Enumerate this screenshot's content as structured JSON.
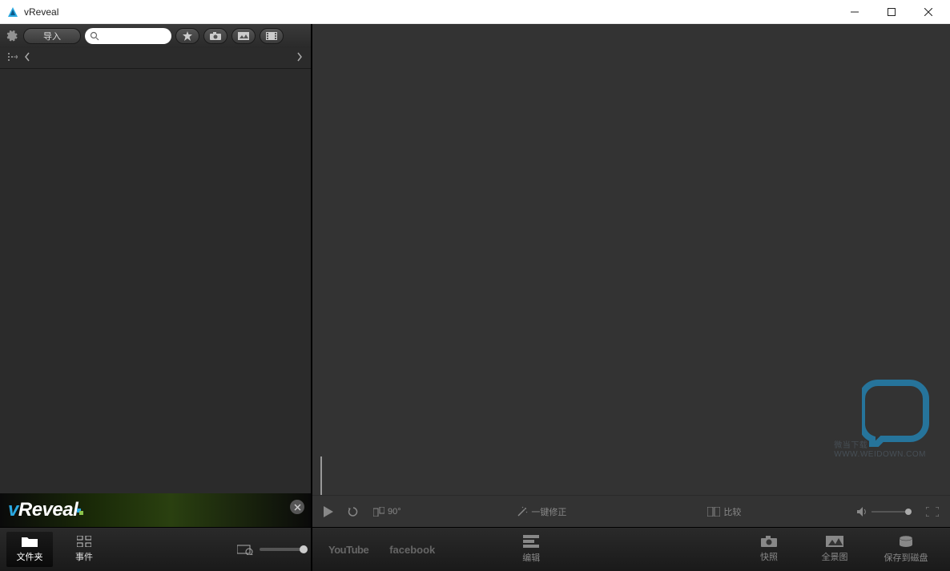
{
  "window": {
    "title": "vReveal"
  },
  "toolbar": {
    "import_label": "导入",
    "search_placeholder": ""
  },
  "banner": {
    "brand_v": "v",
    "brand_rest": "Reveal"
  },
  "tabs": {
    "folders": "文件夹",
    "events": "事件"
  },
  "player": {
    "rotate_label": "90°",
    "onekey_fix": "一键修正",
    "compare": "比较"
  },
  "services": {
    "youtube": "YouTube",
    "facebook": "facebook"
  },
  "actions": {
    "edit": "编辑",
    "snapshot": "快照",
    "panorama": "全景图",
    "save_disk": "保存到磁盘"
  },
  "watermark": {
    "url": "WWW.WEIDOWN.COM",
    "label": "微当下载"
  }
}
